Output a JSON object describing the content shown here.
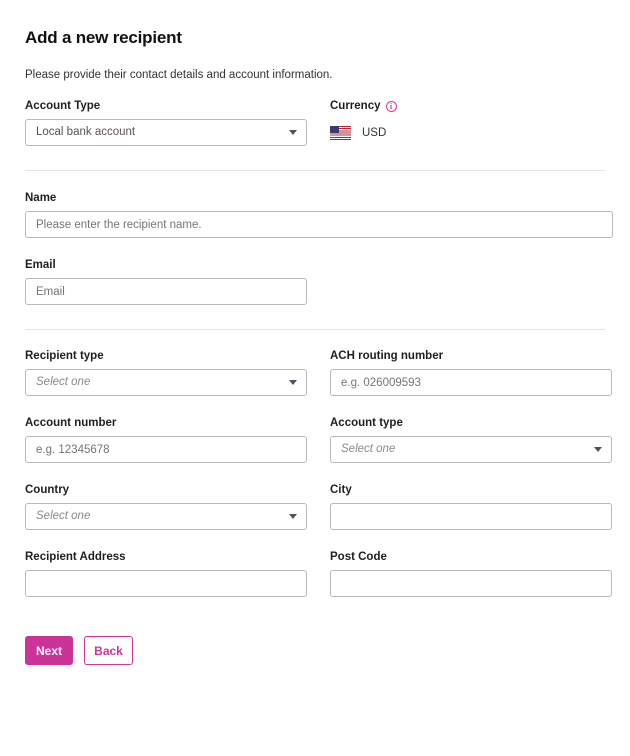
{
  "header": {
    "title": "Add a new recipient",
    "subtitle": "Please provide their contact details and account information."
  },
  "account_type_section": {
    "account_type": {
      "label": "Account Type",
      "value": "Local bank account",
      "icon": "chevron-down-icon"
    },
    "currency": {
      "label": "Currency",
      "info_icon": "info-icon",
      "info_glyph": "i",
      "flag_icon": "us-flag-icon",
      "code": "USD"
    }
  },
  "contact_section": {
    "name": {
      "label": "Name",
      "value": "",
      "placeholder": "Please enter the recipient name."
    },
    "email": {
      "label": "Email",
      "value": "",
      "placeholder": "Email"
    }
  },
  "bank_section": {
    "recipient_type": {
      "label": "Recipient type",
      "value": "",
      "placeholder": "Select one",
      "icon": "chevron-down-icon"
    },
    "ach_routing_number": {
      "label": "ACH routing number",
      "value": "",
      "placeholder": "e.g. 026009593"
    },
    "account_number": {
      "label": "Account number",
      "value": "",
      "placeholder": "e.g. 12345678"
    },
    "account_type": {
      "label": "Account type",
      "value": "",
      "placeholder": "Select one",
      "icon": "chevron-down-icon"
    },
    "country": {
      "label": "Country",
      "value": "",
      "placeholder": "Select one",
      "icon": "chevron-down-icon"
    },
    "city": {
      "label": "City",
      "value": "",
      "placeholder": ""
    },
    "recipient_address": {
      "label": "Recipient Address",
      "value": "",
      "placeholder": ""
    },
    "post_code": {
      "label": "Post Code",
      "value": "",
      "placeholder": ""
    }
  },
  "footer": {
    "next_label": "Next",
    "back_label": "Back"
  },
  "colors": {
    "accent": "#cc3399",
    "border": "#b9b9b9",
    "divider": "#e4e4e4",
    "placeholder": "#8a8a8a"
  }
}
